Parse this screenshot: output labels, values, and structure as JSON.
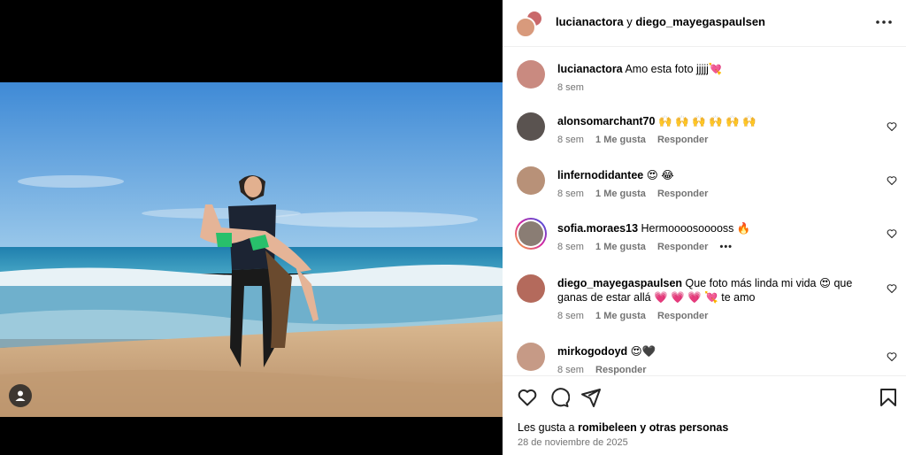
{
  "header": {
    "author1": "lucianactora",
    "connector": " y ",
    "author2": "diego_mayegaspaulsen",
    "more_icon": "more-horizontal-icon"
  },
  "caption": {
    "user": "lucianactora",
    "text": "Amo esta foto jjjjj💘",
    "time": "8 sem"
  },
  "comments": [
    {
      "user": "alonsomarchant70",
      "text": "🙌 🙌 🙌 🙌 🙌 🙌",
      "time": "8 sem",
      "likes": "1 Me gusta",
      "reply": "Responder"
    },
    {
      "user": "linfernodidantee",
      "text": "😍 😂",
      "time": "8 sem",
      "likes": "1 Me gusta",
      "reply": "Responder"
    },
    {
      "user": "sofia.moraes13",
      "text": "Hermoooosooooss 🔥",
      "time": "8 sem",
      "likes": "1 Me gusta",
      "reply": "Responder",
      "more": "•••"
    },
    {
      "user": "diego_mayegaspaulsen",
      "text": "Que foto más linda mi vida 😍 que ganas de estar allá 💗 💗 💗 💘 te amo",
      "time": "8 sem",
      "likes": "1 Me gusta",
      "reply": "Responder"
    },
    {
      "user": "mirkogodoyd",
      "text": "😍🖤",
      "time": "8 sem",
      "reply": "Responder"
    }
  ],
  "footer": {
    "likes_prefix": "Les gusta a ",
    "likes_user": "romibeleen",
    "likes_suffix": " y otras personas",
    "date": "28 de noviembre de 2025"
  },
  "colors": {
    "sky": "#4b93d8",
    "sea": "#2a8fb5",
    "sand": "#c9a57f",
    "muted": "#737373",
    "story_ring": "#d6249f"
  }
}
